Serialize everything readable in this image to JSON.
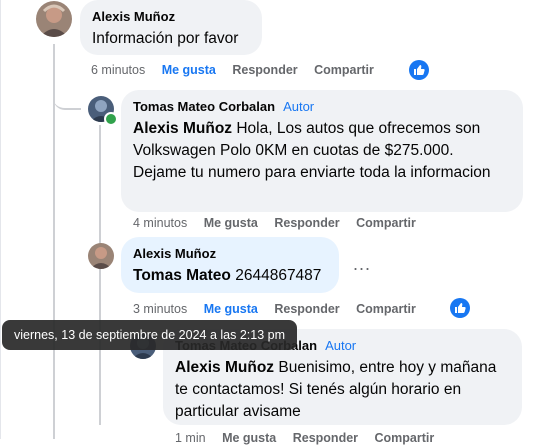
{
  "comments": [
    {
      "author": "Alexis Muñoz",
      "text": "Información por favor",
      "time": "6 minutos",
      "like": "Me gusta",
      "reply": "Responder",
      "share": "Compartir"
    },
    {
      "author": "Tomas Mateo Corbalan",
      "role": "Autor",
      "mention": "Alexis Muñoz",
      "text": "Hola, Los autos que ofrecemos son Volkswagen Polo 0KM en cuotas de $275.000. Dejame tu numero para enviarte toda la informacion",
      "time": "4 minutos",
      "like": "Me gusta",
      "reply": "Responder",
      "share": "Compartir"
    },
    {
      "author": "Alexis Muñoz",
      "mention": "Tomas Mateo",
      "text": "2644867487",
      "more": "...",
      "time": "3 minutos",
      "like": "Me gusta",
      "reply": "Responder",
      "share": "Compartir"
    },
    {
      "author": "Tomas Mateo Corbalan",
      "role": "Autor",
      "mention": "Alexis Muñoz",
      "text": "Buenisimo, entre hoy y mañana te contactamos! Si tenés algún horario en particular avisame",
      "time": "1 min",
      "like": "Me gusta",
      "reply": "Responder",
      "share": "Compartir"
    }
  ],
  "tooltip": "viernes, 13 de septiembre de 2024 a las 2:13 pm",
  "colors": {
    "accent": "#1877f2",
    "bubble": "#f0f2f5",
    "bubble_active": "#e7f3ff",
    "meta": "#65676b"
  }
}
